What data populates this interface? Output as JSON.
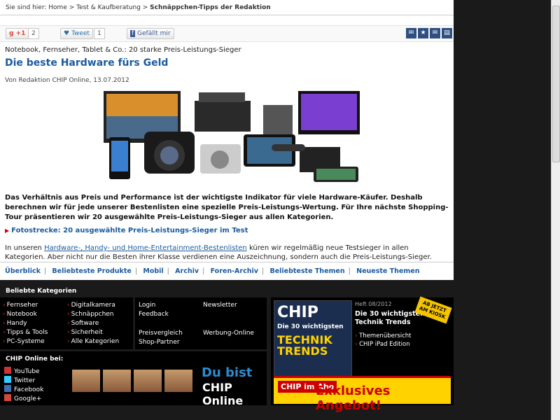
{
  "breadcrumb": {
    "prefix": "Sie sind hier:",
    "home": "Home",
    "sep1": ">",
    "item1": "Test & Kaufberatung",
    "sep2": ">",
    "current": "Schnäppchen-Tipps der Redaktion"
  },
  "share": {
    "gplus_label": "+1",
    "gplus_count": "2",
    "tweet_label": "Tweet",
    "tweet_count": "1",
    "facebook_label": "Gefällt mir",
    "tool_icons": [
      "comment-icon",
      "star-icon",
      "mail-icon",
      "print-icon"
    ]
  },
  "article": {
    "kicker": "Notebook, Fernseher, Tablet & Co.: 20 starke Preis-Leistungs-Sieger",
    "title": "Die beste Hardware fürs Geld",
    "byline": "Von Redaktion CHIP Online, 13.07.2012",
    "intro": "Das Verhältnis aus Preis und Performance ist der wichtigste Indikator für viele Hardware-Käufer. Deshalb berechnen wir für jede unserer Bestenlisten eine spezielle Preis-Leistungs-Wertung. Für Ihre nächste Shopping-Tour präsentieren wir 20 ausgewählte Preis-Leistungs-Sieger aus allen Kategorien.",
    "fotostrecke_link": "Fotostrecke: 20 ausgewählte Preis-Leistungs-Sieger im Test",
    "body_pre": "In unseren",
    "body_link": "Hardware-, Handy- und Home-Entertainment-Bestenlisten",
    "body_post": "küren wir regelmäßig neue Testsieger in allen Kategorien. Aber nicht nur die Besten ihrer Klasse verdienen eine Auszeichnung, sondern auch die Preis-Leistungs-Sieger."
  },
  "navbar": [
    "Überblick",
    "Beliebteste Produkte",
    "Mobil",
    "Archiv",
    "Foren-Archiv",
    "Beliebteste Themen",
    "Neueste Themen"
  ],
  "footer": {
    "heading": "Beliebte Kategorien",
    "categories_col1": [
      "Fernseher",
      "Notebook",
      "Handy",
      "Tipps & Tools",
      "PC-Systeme"
    ],
    "categories_col2": [
      "Digitalkamera",
      "Schnäppchen",
      "Software",
      "Sicherheit",
      "Alle Kategorien"
    ],
    "links_col1": [
      "Login",
      "Feedback",
      "Preisvergleich",
      "Shop-Partner"
    ],
    "links_col2": [
      "Newsletter",
      "Werbung-Online"
    ],
    "chip_bei": "CHIP Online bei:",
    "social": [
      "YouTube",
      "Twitter",
      "Facebook",
      "Google+"
    ],
    "slogan_1": "Du bist",
    "slogan_2": "CHIP Online"
  },
  "promo": {
    "cover_logo": "CHIP",
    "cover_headline": "TECHNIK TRENDS",
    "cover_number": "Die 30 wichtigsten",
    "issue": "Heft 08/2012",
    "headline": "Die 30 wichtigsten Technik Trends",
    "items": [
      "Themenübersicht",
      "CHIP iPad Edition"
    ],
    "badge": "AB JETZT AM KIOSK",
    "abo_small": "CHIP im Abo",
    "abo_big": "Exklusives Angebot!"
  }
}
